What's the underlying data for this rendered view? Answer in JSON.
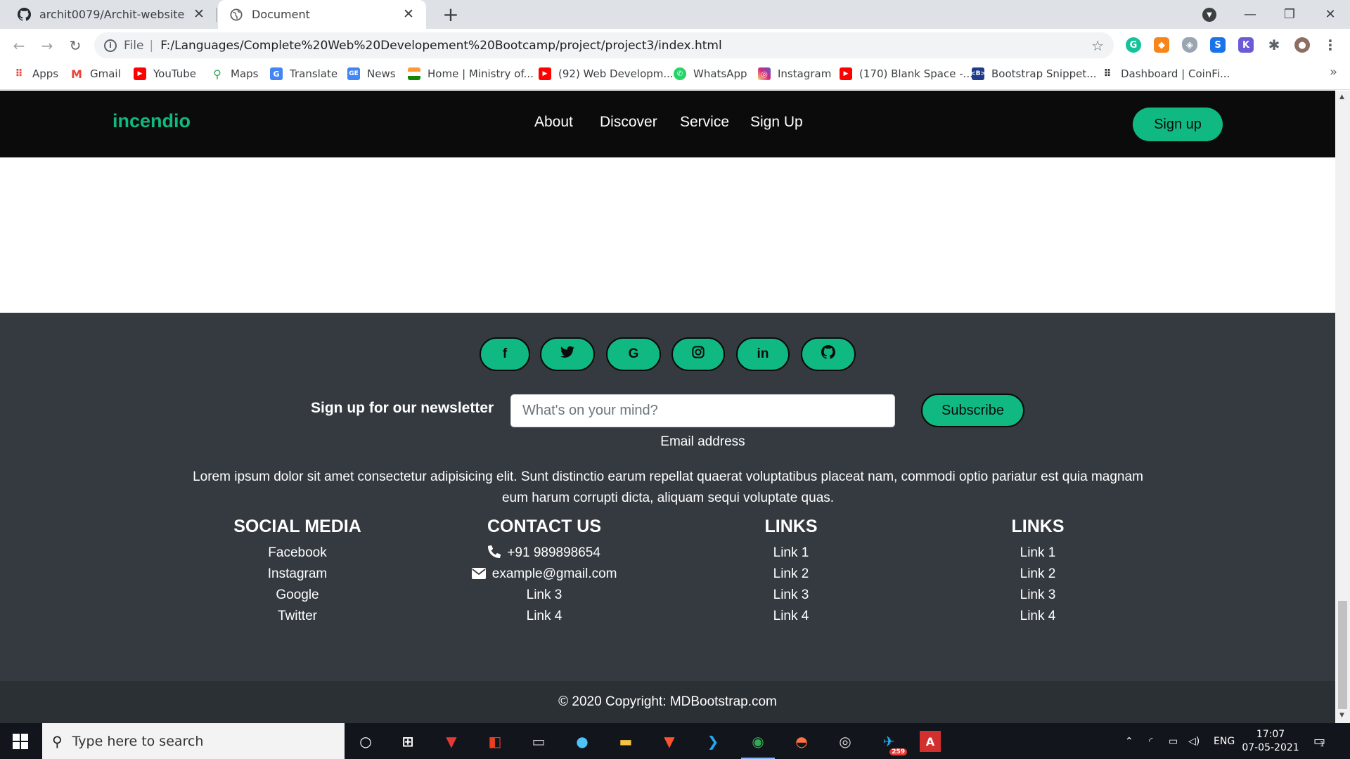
{
  "browser": {
    "tabs": [
      {
        "title": "archit0079/Archit-website",
        "icon": "github-icon"
      },
      {
        "title": "Document",
        "icon": "globe-icon"
      }
    ],
    "close_glyph": "✕",
    "new_tab_glyph": "+",
    "window_controls": {
      "minimize": "—",
      "maximize": "❐",
      "close": "✕"
    },
    "address": {
      "scheme": "File",
      "url": "F:/Languages/Complete%20Web%20Developement%20Bootcamp/project/project3/index.html"
    },
    "bookmarks": [
      "Apps",
      "Gmail",
      "YouTube",
      "Maps",
      "Translate",
      "News",
      "Home | Ministry of...",
      "(92) Web Developm...",
      "WhatsApp",
      "Instagram",
      "(170) Blank Space -...",
      "Bootstrap Snippet...",
      "Dashboard | CoinFi..."
    ],
    "more_bookmarks": "»"
  },
  "site": {
    "brand": "incendio",
    "nav": [
      "About",
      "Discover",
      "Service",
      "Sign Up"
    ],
    "signup_button": "Sign up",
    "accent_color": "#10b981"
  },
  "footer": {
    "social_icons": [
      "facebook-icon",
      "twitter-icon",
      "google-icon",
      "instagram-icon",
      "linkedin-icon",
      "github-icon"
    ],
    "social_glyphs": [
      "f",
      "t",
      "G",
      "◎",
      "in",
      "⌾"
    ],
    "newsletter": {
      "label": "Sign up for our newsletter",
      "placeholder": "What's on your mind?",
      "help": "Email address",
      "button": "Subscribe"
    },
    "lorem": "Lorem ipsum dolor sit amet consectetur adipisicing elit. Sunt distinctio earum repellat quaerat voluptatibus placeat nam, commodi optio pariatur est quia magnam eum harum corrupti dicta, aliquam sequi voluptate quas.",
    "columns": [
      {
        "title": "SOCIAL MEDIA",
        "items": [
          "Facebook",
          "Instagram",
          "Google",
          "Twitter"
        ]
      },
      {
        "title": "CONTACT US",
        "items": [
          "+91 989898654",
          "example@gmail.com",
          "Link 3",
          "Link 4"
        ]
      },
      {
        "title": "LINKS",
        "items": [
          "Link 1",
          "Link 2",
          "Link 3",
          "Link 4"
        ]
      },
      {
        "title": "LINKS",
        "items": [
          "Link 1",
          "Link 2",
          "Link 3",
          "Link 4"
        ]
      }
    ],
    "contact_icons": [
      "phone-icon",
      "envelope-icon"
    ],
    "copyright": "© 2020 Copyright: MDBootstrap.com"
  },
  "taskbar": {
    "search_placeholder": "Type here to search",
    "language": "ENG",
    "time": "17:07",
    "date": "07-05-2021",
    "telegram_badge": "259",
    "notification_count": "1"
  }
}
